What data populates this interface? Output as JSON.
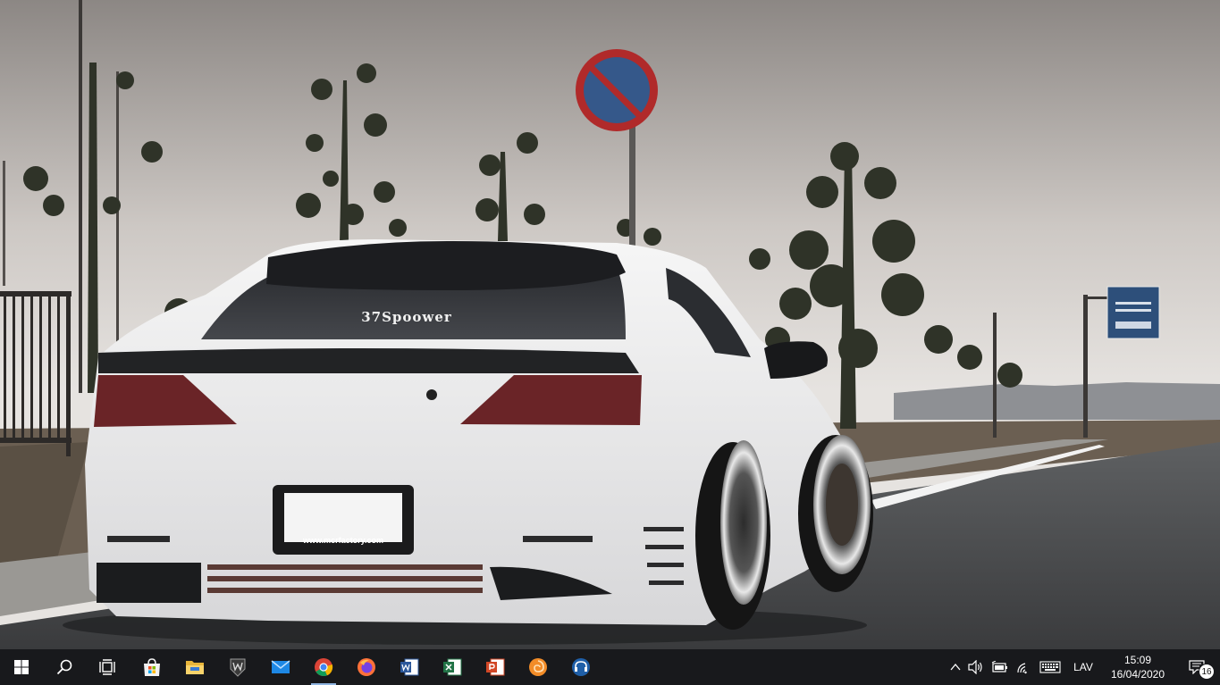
{
  "taskbar": {
    "pinned_apps": [
      {
        "name": "microsoft-store",
        "active": false
      },
      {
        "name": "file-explorer",
        "active": false
      },
      {
        "name": "world-of-tanks",
        "active": false
      },
      {
        "name": "mail",
        "active": false
      },
      {
        "name": "chrome",
        "active": true
      },
      {
        "name": "firefox",
        "active": false
      },
      {
        "name": "word",
        "active": false
      },
      {
        "name": "excel",
        "active": false
      },
      {
        "name": "powerpoint",
        "active": false
      },
      {
        "name": "app-orange-swirl",
        "active": false
      },
      {
        "name": "headset-app",
        "active": false
      }
    ],
    "tray": {
      "language": "LAV",
      "time": "15:09",
      "date": "16/04/2020",
      "notification_count": "16"
    }
  },
  "wallpaper": {
    "plate_text": "www.mcrfactory.com",
    "window_text": "37Spoower"
  },
  "colors": {
    "taskbar_bg": "#18191c",
    "accent_underline": "#8fb4e0",
    "sky": "#d9d5d2",
    "car_body": "#eeeeee"
  }
}
